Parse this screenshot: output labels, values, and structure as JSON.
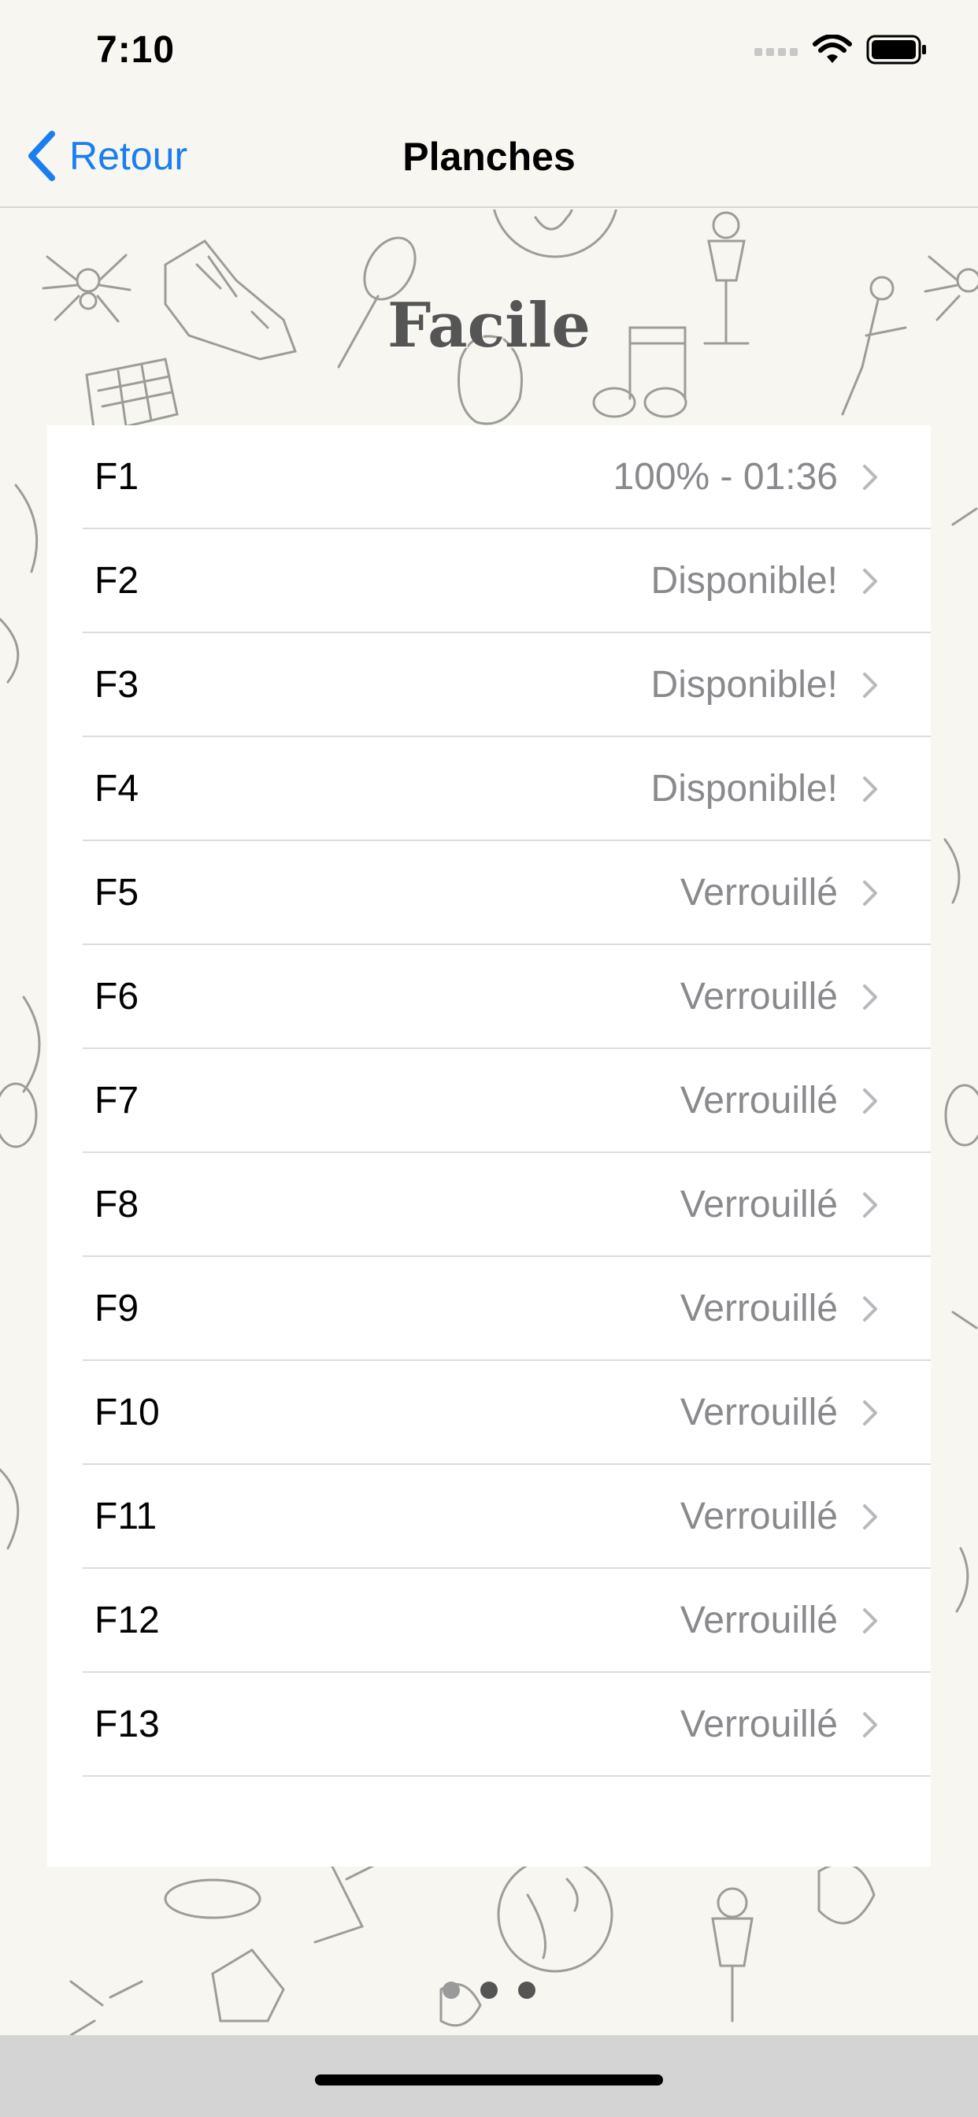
{
  "status_bar": {
    "time": "7:10"
  },
  "nav": {
    "back_label": "Retour",
    "title": "Planches"
  },
  "section": {
    "title": "Facile"
  },
  "levels": [
    {
      "label": "F1",
      "status": "100% - 01:36"
    },
    {
      "label": "F2",
      "status": "Disponible!"
    },
    {
      "label": "F3",
      "status": "Disponible!"
    },
    {
      "label": "F4",
      "status": "Disponible!"
    },
    {
      "label": "F5",
      "status": "Verrouillé"
    },
    {
      "label": "F6",
      "status": "Verrouillé"
    },
    {
      "label": "F7",
      "status": "Verrouillé"
    },
    {
      "label": "F8",
      "status": "Verrouillé"
    },
    {
      "label": "F9",
      "status": "Verrouillé"
    },
    {
      "label": "F10",
      "status": "Verrouillé"
    },
    {
      "label": "F11",
      "status": "Verrouillé"
    },
    {
      "label": "F12",
      "status": "Verrouillé"
    },
    {
      "label": "F13",
      "status": "Verrouillé"
    }
  ],
  "pagination": {
    "pages": 3,
    "current": 1
  },
  "colors": {
    "accent": "#1a7ef0",
    "secondary_text": "#8a8a8e",
    "background": "#f7f6f1"
  }
}
